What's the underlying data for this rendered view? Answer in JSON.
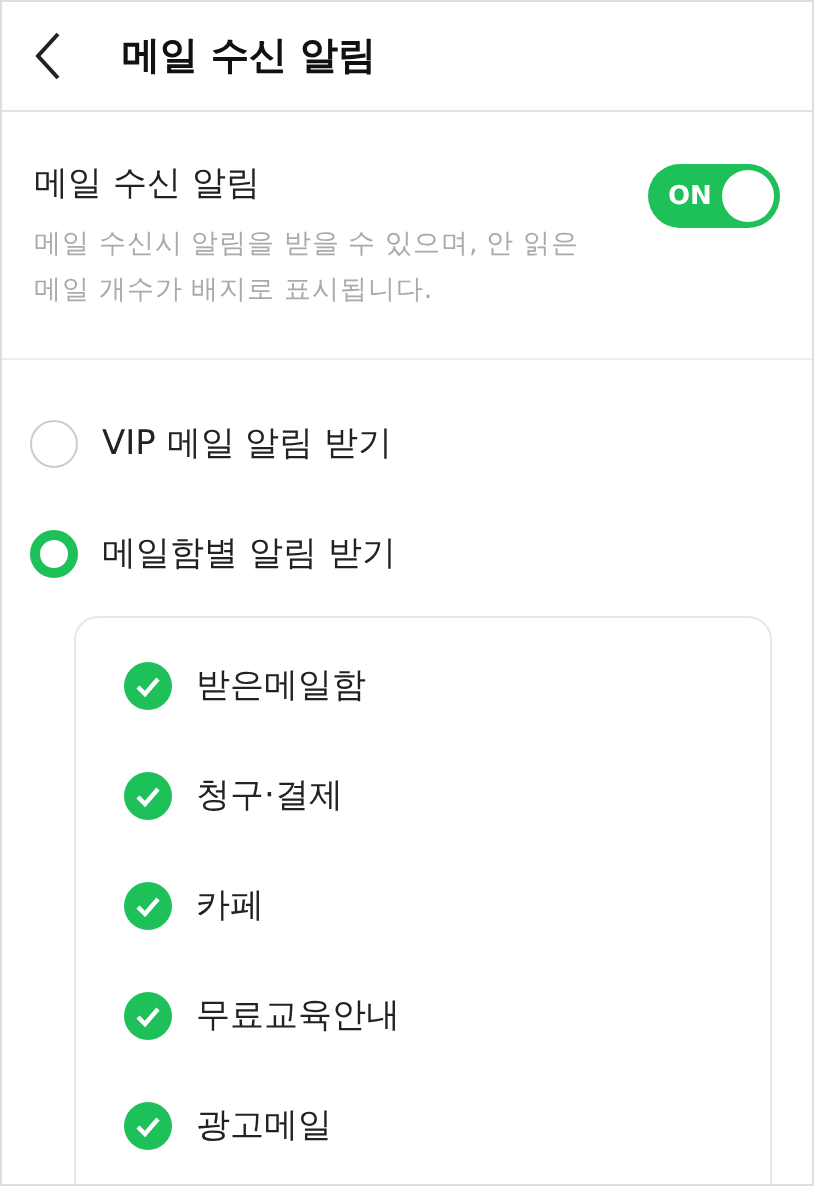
{
  "header": {
    "title": "메일 수신 알림"
  },
  "notification": {
    "label": "메일 수신 알림",
    "description": "메일 수신시 알림을 받을 수 있으며, 안 읽은 메일 개수가 배지로 표시됩니다.",
    "toggle": {
      "on": true,
      "text": "ON"
    }
  },
  "options": [
    {
      "label": "VIP 메일 알림 받기",
      "selected": false
    },
    {
      "label": "메일함별 알림 받기",
      "selected": true
    }
  ],
  "mailboxes": [
    {
      "label": "받은메일함",
      "checked": true
    },
    {
      "label": "청구·결제",
      "checked": true
    },
    {
      "label": "카페",
      "checked": true
    },
    {
      "label": "무료교육안내",
      "checked": true
    },
    {
      "label": "광고메일",
      "checked": true
    }
  ]
}
